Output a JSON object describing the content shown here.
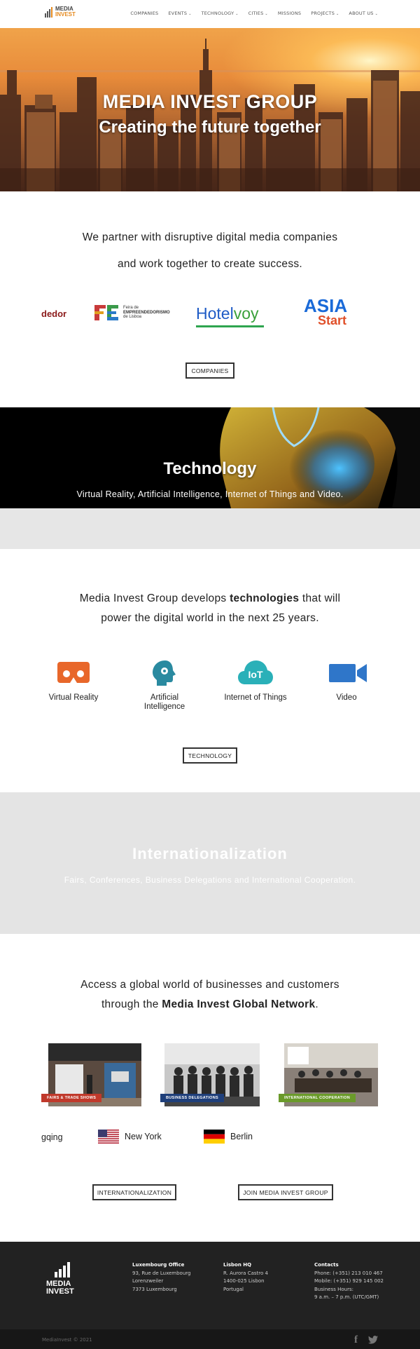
{
  "header": {
    "logo_line1": "MEDIA",
    "logo_line2": "INVEST",
    "nav": [
      {
        "label": "COMPANIES",
        "dropdown": false
      },
      {
        "label": "EVENTS",
        "dropdown": true
      },
      {
        "label": "TECHNOLOGY",
        "dropdown": true
      },
      {
        "label": "CITIES",
        "dropdown": true
      },
      {
        "label": "MISSIONS",
        "dropdown": false
      },
      {
        "label": "PROJECTS",
        "dropdown": true
      },
      {
        "label": "ABOUT US",
        "dropdown": true
      }
    ]
  },
  "hero": {
    "title": "MEDIA INVEST GROUP",
    "subtitle": "Creating the future together"
  },
  "partners": {
    "text_line1": "We partner with disruptive digital media companies",
    "text_line2": "and work together to create success.",
    "logos": {
      "dedor": "dedor",
      "feira_l1": "Feira de",
      "feira_l2": "EMPREENDEDORISMO",
      "feira_l3": "de Lisboa",
      "hotel1": "Hotel",
      "hotel2": "voy",
      "asia1": "ASIA",
      "asia2": "Start"
    },
    "button": "COMPANIES"
  },
  "technology_banner": {
    "title": "Technology",
    "subtitle": "Virtual Reality, Artificial Intelligence, Internet of Things and Video."
  },
  "technology": {
    "text_line1_pre": "Media Invest Group develops ",
    "text_line1_bold": "technologies",
    "text_line1_post": " that will",
    "text_line2": "power the digital world in the next 25 years.",
    "items": [
      {
        "label": "Virtual Reality",
        "icon": "vr-headset-icon"
      },
      {
        "label": "Artificial Intelligence",
        "icon": "ai-head-icon"
      },
      {
        "label": "Internet of Things",
        "icon": "iot-cloud-icon",
        "badge": "IoT"
      },
      {
        "label": "Video",
        "icon": "video-camera-icon"
      }
    ],
    "button": "TECHNOLOGY"
  },
  "internationalization": {
    "title": "Internationalization",
    "subtitle": "Fairs, Conferences, Business Delegations and International Cooperation."
  },
  "network": {
    "text_line1": "Access a global world of businesses and customers",
    "text_line2_pre": "through the ",
    "text_line2_bold": "Media Invest Global Network",
    "text_line2_post": ".",
    "photos": [
      {
        "badge": "FAIRS & TRADE SHOWS",
        "badge_color": "#c0392b"
      },
      {
        "badge": "BUSINESS DELEGATIONS",
        "badge_color": "#1f3f7a"
      },
      {
        "badge": "INTERNATIONAL COOPERATION",
        "badge_color": "#6a9a2a"
      }
    ],
    "cities": [
      {
        "name": "gqing",
        "flag": "none"
      },
      {
        "name": "New York",
        "flag": "us-flag-icon"
      },
      {
        "name": "Berlin",
        "flag": "germany-flag-icon"
      }
    ],
    "button_intl": "INTERNATIONALIZATION",
    "button_join": "JOIN MEDIA INVEST GROUP"
  },
  "footer": {
    "logo_line1": "MEDIA",
    "logo_line2": "INVEST",
    "luxembourg": {
      "heading": "Luxembourg Office",
      "l1": "93, Rue de Luxembourg",
      "l2": "Lorenzweiler",
      "l3": "7373 Luxembourg"
    },
    "lisbon": {
      "heading": "Lisbon HQ",
      "l1": "R. Aurora Castro 4",
      "l2": "1400-025 Lisbon",
      "l3": "Portugal"
    },
    "contacts": {
      "heading": "Contacts",
      "l1": "Phone: (+351) 213 010 467",
      "l2": "Mobile: (+351) 929 145 002",
      "l3": "Business Hours:",
      "l4": "9 a.m. – 7 p.m. (UTC/GMT)"
    },
    "copyright": "MediaInvest © 2021",
    "social": {
      "facebook": "f",
      "twitter": "🐦"
    }
  },
  "colors": {
    "accent_orange": "#e58a1f",
    "footer_bg": "#222222",
    "section_gray": "#e4e4e4",
    "tech_orange": "#e8672a",
    "tech_teal": "#2ab0b8",
    "tech_blue": "#2f76c9"
  }
}
